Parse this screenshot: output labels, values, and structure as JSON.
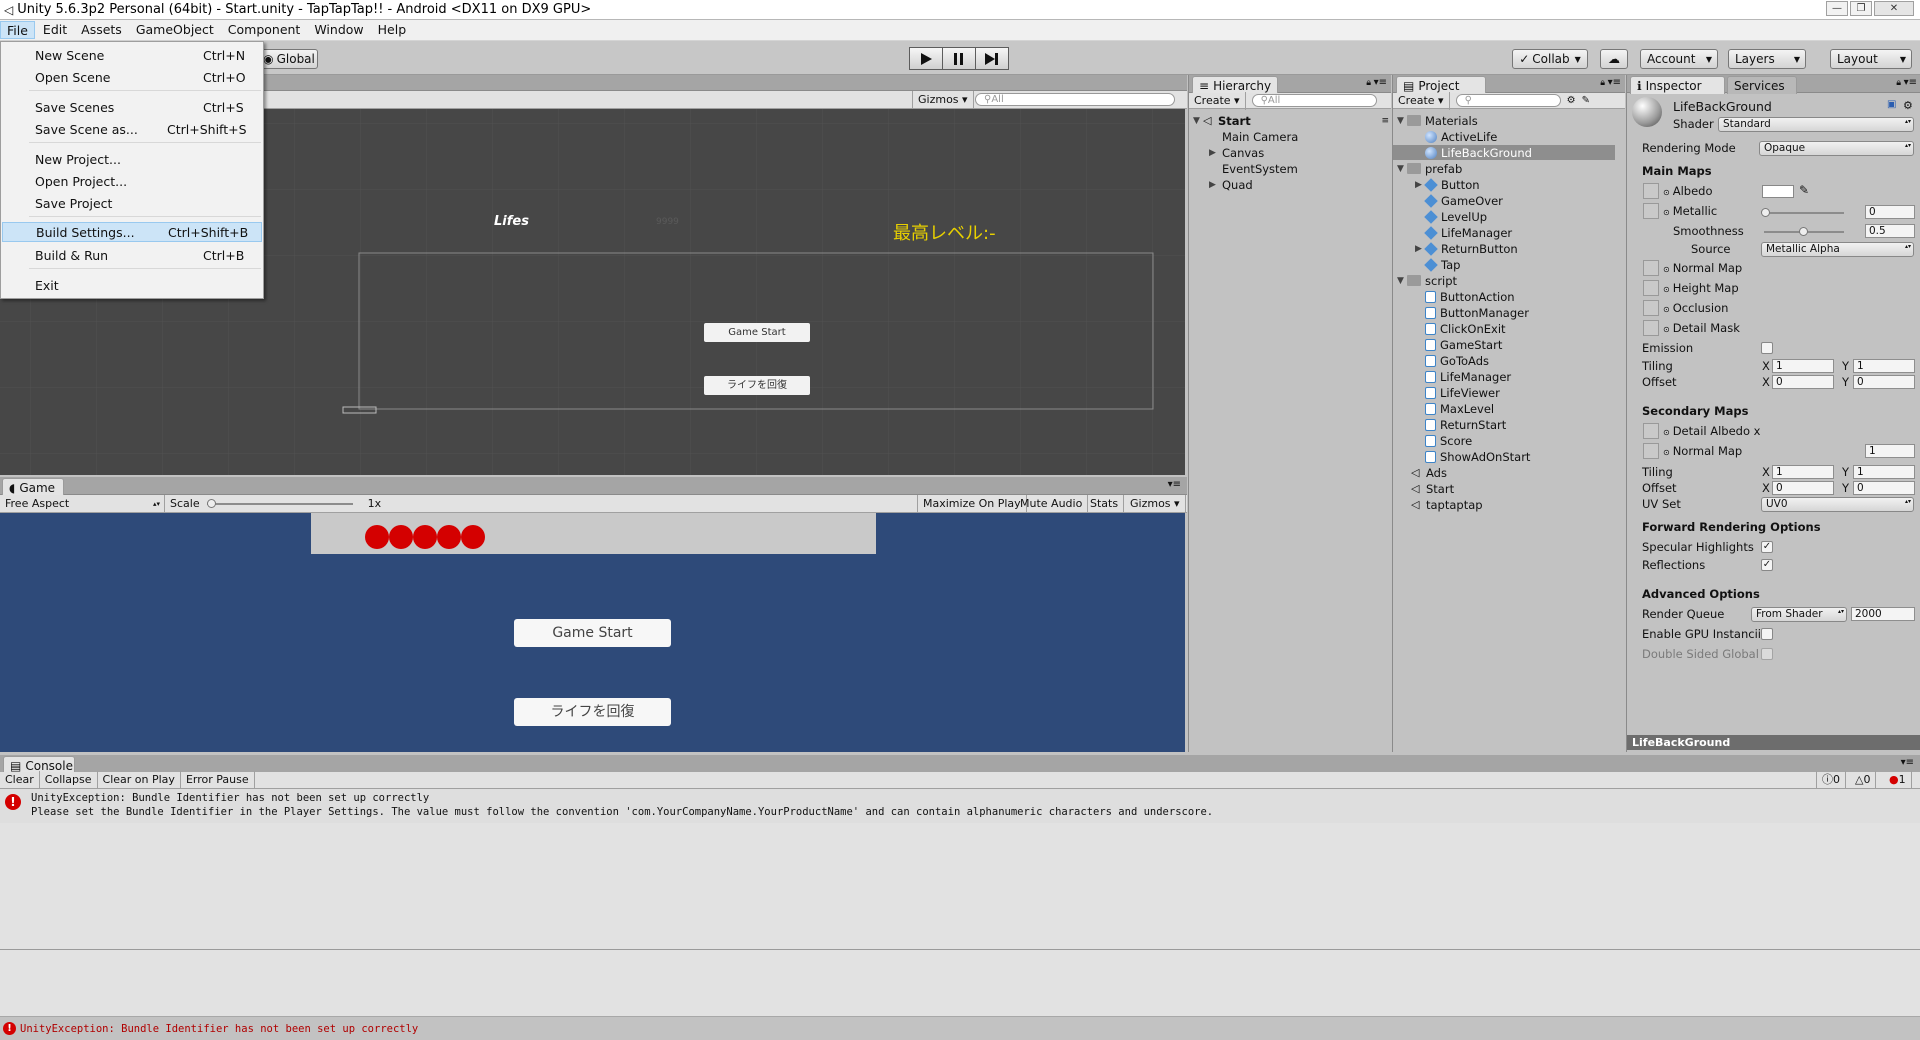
{
  "window": {
    "title": "Unity 5.6.3p2 Personal (64bit) - Start.unity - TapTapTap!! - Android <DX11 on DX9 GPU>",
    "controls": [
      "—",
      "❐",
      "✕"
    ]
  },
  "menubar": [
    "File",
    "Edit",
    "Assets",
    "GameObject",
    "Component",
    "Window",
    "Help"
  ],
  "file_menu": {
    "items": [
      {
        "label": "New Scene",
        "shortcut": "Ctrl+N"
      },
      {
        "label": "Open Scene",
        "shortcut": "Ctrl+O"
      },
      {
        "label": "Save Scenes",
        "shortcut": "Ctrl+S"
      },
      {
        "label": "Save Scene as...",
        "shortcut": "Ctrl+Shift+S"
      },
      {
        "label": "New Project...",
        "shortcut": ""
      },
      {
        "label": "Open Project...",
        "shortcut": ""
      },
      {
        "label": "Save Project",
        "shortcut": ""
      },
      {
        "label": "Build Settings...",
        "shortcut": "Ctrl+Shift+B"
      },
      {
        "label": "Build & Run",
        "shortcut": "Ctrl+B"
      },
      {
        "label": "Exit",
        "shortcut": ""
      }
    ],
    "highlighted": "Build Settings..."
  },
  "toolbar": {
    "global_label": "Global",
    "collab_label": "Collab",
    "account_label": "Account",
    "layers_label": "Layers",
    "layout_label": "Layout"
  },
  "scene": {
    "gizmos_label": "Gizmos",
    "search_placeholder": "All",
    "lifes_text": "Lifes",
    "level_text": "最高レベル:-",
    "small_text": "9999",
    "btn_start": "Game Start",
    "btn_recover": "ライフを回復"
  },
  "game": {
    "tab_label": "Game",
    "aspect_label": "Free Aspect",
    "scale_label": "Scale",
    "scale_value": "1x",
    "buttons": [
      "Maximize On Play",
      "Mute Audio",
      "Stats",
      "Gizmos"
    ],
    "life_count": 5,
    "life_color": "#d40000",
    "btn_start": "Game Start",
    "btn_recover": "ライフを回復",
    "bg_color": "#2e4a79"
  },
  "hierarchy": {
    "tab_label": "Hierarchy",
    "create_label": "Create",
    "search_placeholder": "All",
    "scene_name": "Start",
    "items": [
      "Main Camera",
      "Canvas",
      "EventSystem",
      "Quad"
    ]
  },
  "project": {
    "tab_label": "Project",
    "create_label": "Create",
    "materials_folder": "Materials",
    "materials": [
      "ActiveLife",
      "LifeBackGround"
    ],
    "selected": "LifeBackGround",
    "prefab_folder": "prefab",
    "prefabs": [
      "Button",
      "GameOver",
      "LevelUp",
      "LifeManager",
      "ReturnButton",
      "Tap"
    ],
    "script_folder": "script",
    "scripts": [
      "ButtonAction",
      "ButtonManager",
      "ClickOnExit",
      "GameStart",
      "GoToAds",
      "LifeManager",
      "LifeViewer",
      "MaxLevel",
      "ReturnStart",
      "Score",
      "ShowAdOnStart"
    ],
    "scenes": [
      "Ads",
      "Start",
      "taptaptap"
    ]
  },
  "inspector": {
    "tab_label": "Inspector",
    "services_label": "Services",
    "material_name": "LifeBackGround",
    "shader_label": "Shader",
    "shader_value": "Standard",
    "rendering_mode_label": "Rendering Mode",
    "rendering_mode_value": "Opaque",
    "main_maps": "Main Maps",
    "albedo": "Albedo",
    "metallic": "Metallic",
    "metallic_value": "0",
    "smoothness": "Smoothness",
    "smoothness_value": "0.5",
    "source": "Source",
    "source_value": "Metallic Alpha",
    "normal_map": "Normal Map",
    "height_map": "Height Map",
    "occlusion": "Occlusion",
    "detail_mask": "Detail Mask",
    "emission": "Emission",
    "tiling": "Tiling",
    "offset": "Offset",
    "x_label": "X",
    "y_label": "Y",
    "tiling_x": "1",
    "tiling_y": "1",
    "offset_x": "0",
    "offset_y": "0",
    "secondary_maps": "Secondary Maps",
    "detail_albedo": "Detail Albedo x",
    "normal_map2": "Normal Map",
    "normal_map2_value": "1",
    "tiling2_x": "1",
    "tiling2_y": "1",
    "offset2_x": "0",
    "offset2_y": "0",
    "uv_set": "UV Set",
    "uv_set_value": "UV0",
    "forward_options": "Forward Rendering Options",
    "specular": "Specular Highlights",
    "reflections": "Reflections",
    "advanced": "Advanced Options",
    "render_queue": "Render Queue",
    "render_queue_mode": "From Shader",
    "render_queue_value": "2000",
    "gpu_instancing": "Enable GPU Instancii",
    "double_sided": "Double Sided Global",
    "preview_label": "LifeBackGround"
  },
  "console": {
    "tab_label": "Console",
    "buttons": [
      "Clear",
      "Collapse",
      "Clear on Play",
      "Error Pause"
    ],
    "count_info": "0",
    "count_warn": "0",
    "count_err": "1",
    "error_line1": "UnityException: Bundle Identifier has not been set up correctly",
    "error_line2": "Please set the Bundle Identifier in the Player Settings. The value must follow the convention 'com.YourCompanyName.YourProductName' and can contain alphanumeric characters and underscore.",
    "status_text": "UnityException: Bundle Identifier has not been set up correctly"
  }
}
